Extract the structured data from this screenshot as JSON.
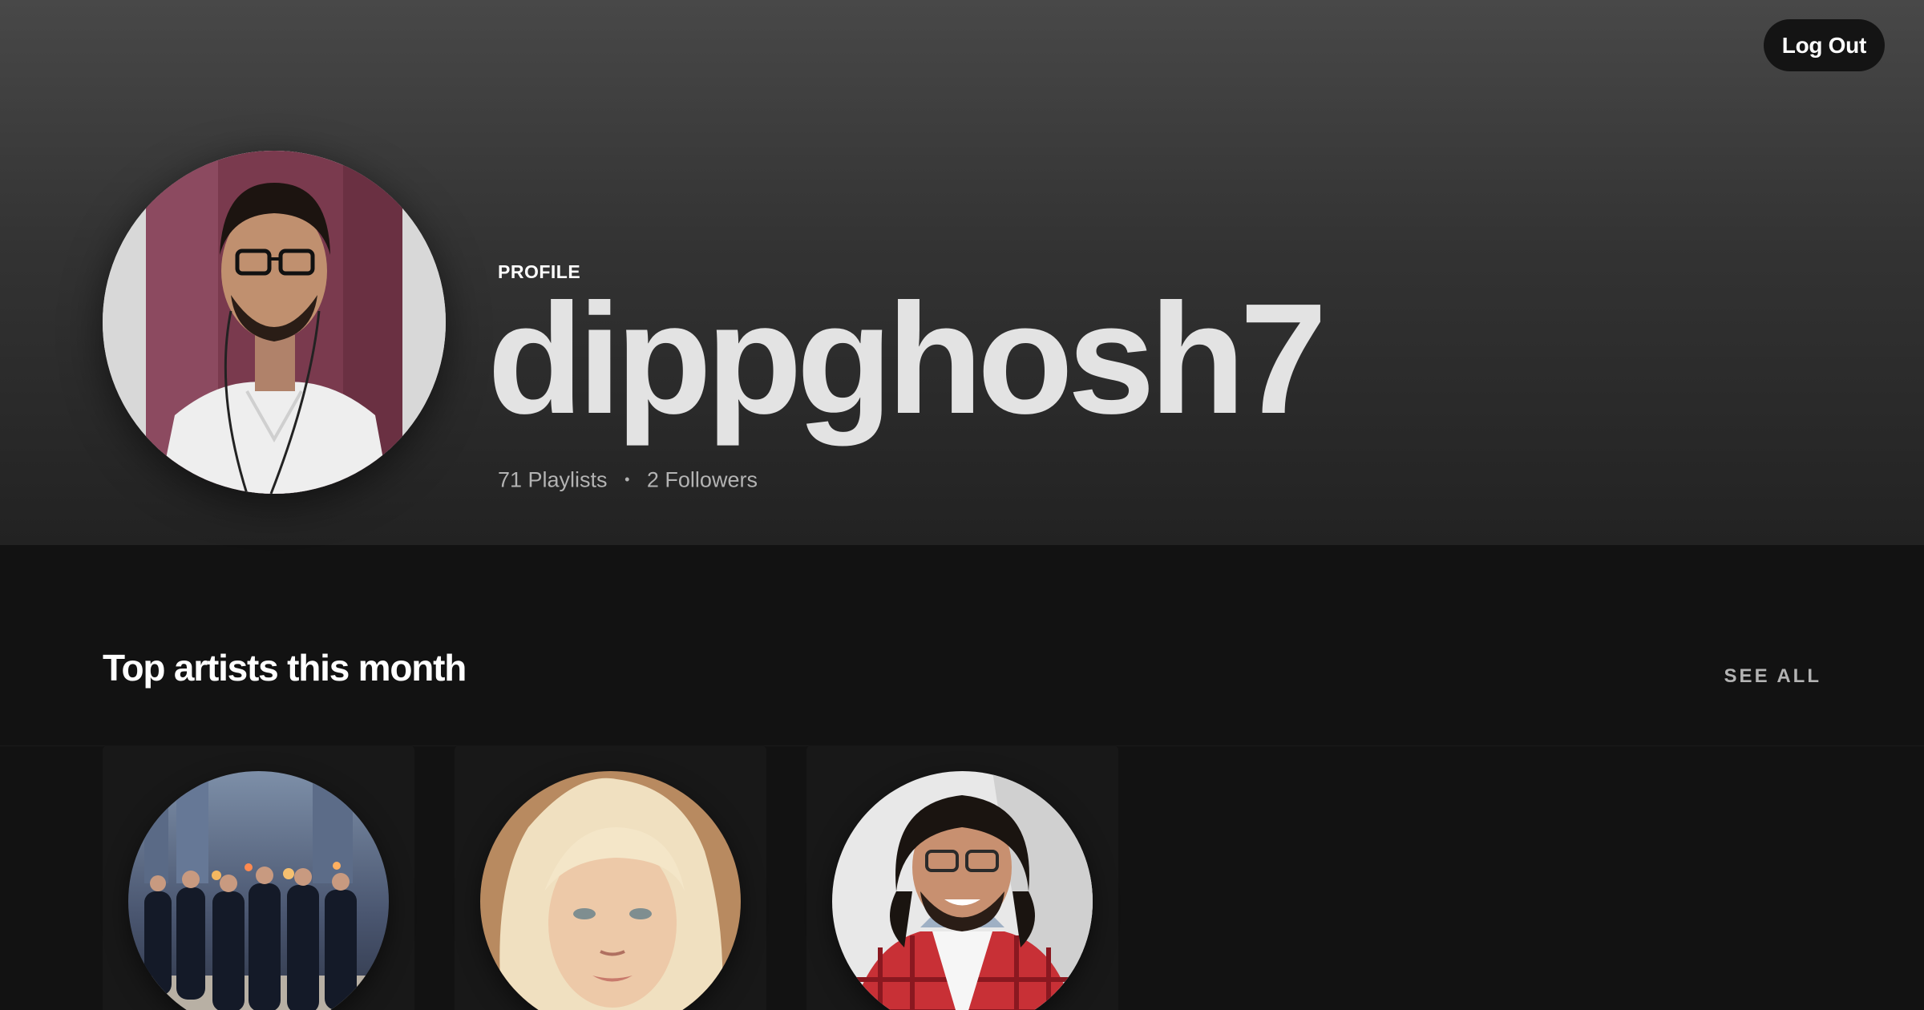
{
  "header": {
    "logout_label": "Log Out",
    "profile_label": "PROFILE",
    "username": "dippghosh7",
    "playlists_text": "71 Playlists",
    "followers_text": "2 Followers",
    "separator": "•"
  },
  "top_artists": {
    "title": "Top artists this month",
    "see_all_label": "SEE ALL",
    "artists": [
      {
        "image": "band-photo-city-night"
      },
      {
        "image": "platinum-blonde-portrait"
      },
      {
        "image": "bearded-man-red-plaid-shirt"
      }
    ]
  },
  "colors": {
    "background": "#121212",
    "header_top": "#484848",
    "card": "#181818",
    "text_primary": "#ffffff",
    "text_secondary": "#b3b3b3"
  }
}
